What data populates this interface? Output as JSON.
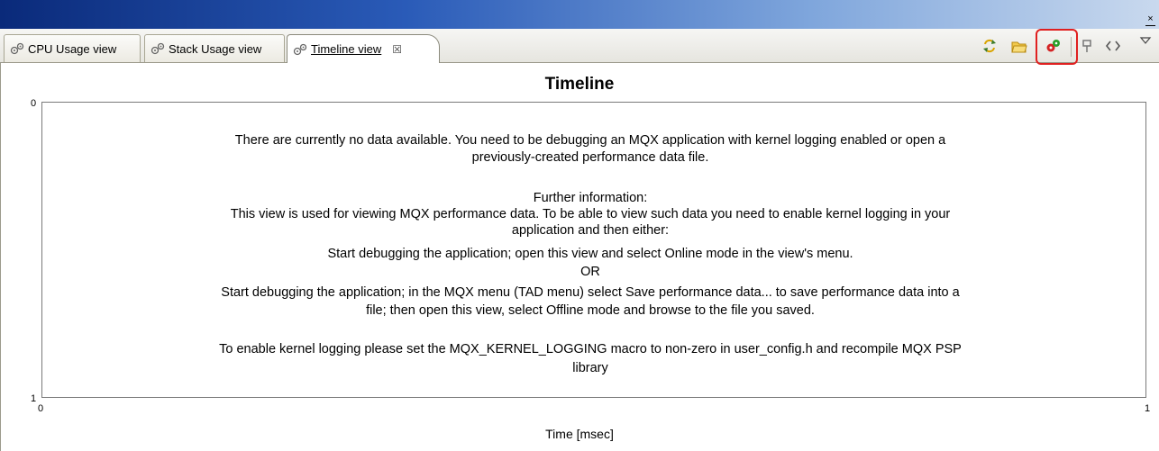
{
  "tabs": [
    {
      "label": "CPU Usage view"
    },
    {
      "label": "Stack Usage view"
    },
    {
      "label": "Timeline view",
      "close": "☒"
    }
  ],
  "toolbar": {
    "icons": [
      "refresh-icon",
      "open-folder-icon",
      "online-mode-icon",
      "pin-icon",
      "code-icon",
      "view-menu-icon"
    ],
    "highlight_color": "#e02020"
  },
  "window": {
    "close": "×"
  },
  "chart": {
    "title": "Timeline",
    "y_top": "0",
    "y_bottom": "1",
    "x_left": "0",
    "x_right": "1",
    "xlabel": "Time [msec]"
  },
  "message": {
    "line1": "There are currently no data available. You need to be debugging an MQX application with kernel logging enabled or open a",
    "line2": "previously-created performance data file.",
    "further": "Further information:",
    "line3": "This view is used for viewing MQX performance data. To be able to view such data you need to enable kernel logging in your",
    "line4": "application and then either:",
    "line5": "Start debugging the application; open this view and select Online mode in the view's menu.",
    "or": "OR",
    "line6": "Start debugging the application; in the MQX menu (TAD menu) select Save performance data... to save performance data into a",
    "line7": "file; then open this view, select Offline mode and browse to the file you saved.",
    "line8": "To enable kernel logging please set the MQX_KERNEL_LOGGING macro to non-zero in user_config.h and recompile MQX PSP",
    "line9": "library"
  }
}
